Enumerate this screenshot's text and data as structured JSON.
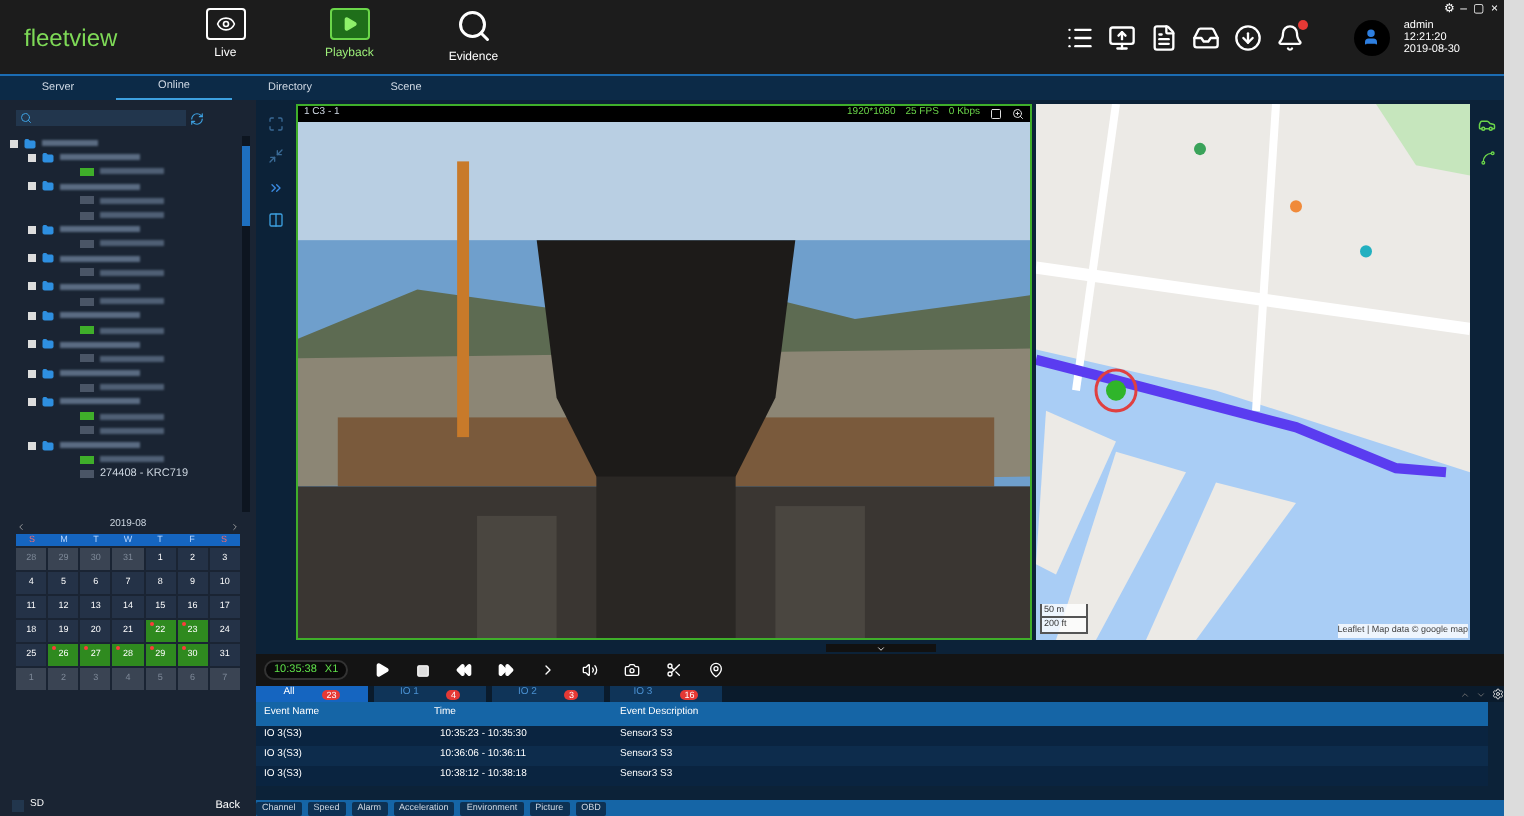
{
  "header": {
    "logo": "fleetview",
    "window_controls": [
      "⚙",
      "–",
      "▢",
      "×"
    ]
  },
  "nav": [
    {
      "kind": "live",
      "label": "Live",
      "selected": false
    },
    {
      "kind": "playback",
      "label": "Playback",
      "selected": true
    },
    {
      "kind": "evidence",
      "label": "Evidence",
      "selected": false
    }
  ],
  "notifications": {
    "unread": true
  },
  "user": {
    "name": "admin",
    "time": "12:21:20",
    "date": "2019-08-30"
  },
  "tabs": [
    {
      "label": "Server",
      "selected": false
    },
    {
      "label": "Online",
      "selected": true
    },
    {
      "label": "Directory",
      "selected": false
    },
    {
      "label": "Scene",
      "selected": false
    }
  ],
  "tree": {
    "checked": false,
    "children": [
      {
        "checked": false,
        "children": [
          {
            "online": true
          }
        ]
      },
      {
        "checked": false,
        "children": [
          {
            "online": false
          },
          {
            "online": false
          }
        ]
      },
      {
        "checked": false,
        "children": [
          {
            "online": false
          }
        ]
      },
      {
        "checked": false,
        "children": [
          {
            "online": false
          }
        ]
      },
      {
        "checked": false,
        "children": [
          {
            "online": false
          }
        ]
      },
      {
        "checked": false,
        "children": [
          {
            "online": true
          }
        ]
      },
      {
        "checked": false,
        "children": [
          {
            "online": false
          }
        ]
      },
      {
        "checked": false,
        "children": [
          {
            "online": false
          }
        ]
      },
      {
        "checked": false,
        "children": [
          {
            "online": true
          },
          {
            "online": false
          }
        ]
      },
      {
        "checked": false,
        "children": [
          {
            "online": true
          },
          {
            "online": false,
            "label": "274408 - KRC719"
          }
        ]
      }
    ]
  },
  "calendar": {
    "month": "2019-08",
    "weekdays": [
      "S",
      "M",
      "T",
      "W",
      "T",
      "F",
      "S"
    ],
    "days": [
      {
        "day": "28",
        "muted": true,
        "recorded": false,
        "alarm": false
      },
      {
        "day": "29",
        "muted": true,
        "recorded": false,
        "alarm": false
      },
      {
        "day": "30",
        "muted": true,
        "recorded": false,
        "alarm": false
      },
      {
        "day": "31",
        "muted": true,
        "recorded": false,
        "alarm": false
      },
      {
        "day": "1",
        "muted": false,
        "recorded": false,
        "alarm": false
      },
      {
        "day": "2",
        "muted": false,
        "recorded": false,
        "alarm": false
      },
      {
        "day": "3",
        "muted": false,
        "recorded": false,
        "alarm": false
      },
      {
        "day": "4",
        "muted": false,
        "recorded": false,
        "alarm": false
      },
      {
        "day": "5",
        "muted": false,
        "recorded": false,
        "alarm": false
      },
      {
        "day": "6",
        "muted": false,
        "recorded": false,
        "alarm": false
      },
      {
        "day": "7",
        "muted": false,
        "recorded": false,
        "alarm": false
      },
      {
        "day": "8",
        "muted": false,
        "recorded": false,
        "alarm": false
      },
      {
        "day": "9",
        "muted": false,
        "recorded": false,
        "alarm": false
      },
      {
        "day": "10",
        "muted": false,
        "recorded": false,
        "alarm": false
      },
      {
        "day": "11",
        "muted": false,
        "recorded": false,
        "alarm": false
      },
      {
        "day": "12",
        "muted": false,
        "recorded": false,
        "alarm": false
      },
      {
        "day": "13",
        "muted": false,
        "recorded": false,
        "alarm": false
      },
      {
        "day": "14",
        "muted": false,
        "recorded": false,
        "alarm": false
      },
      {
        "day": "15",
        "muted": false,
        "recorded": false,
        "alarm": false
      },
      {
        "day": "16",
        "muted": false,
        "recorded": false,
        "alarm": false
      },
      {
        "day": "17",
        "muted": false,
        "recorded": false,
        "alarm": false
      },
      {
        "day": "18",
        "muted": false,
        "recorded": false,
        "alarm": false
      },
      {
        "day": "19",
        "muted": false,
        "recorded": false,
        "alarm": false
      },
      {
        "day": "20",
        "muted": false,
        "recorded": false,
        "alarm": false
      },
      {
        "day": "21",
        "muted": false,
        "recorded": false,
        "alarm": false
      },
      {
        "day": "22",
        "muted": false,
        "recorded": true,
        "alarm": true
      },
      {
        "day": "23",
        "muted": false,
        "recorded": true,
        "alarm": true
      },
      {
        "day": "24",
        "muted": false,
        "recorded": false,
        "alarm": false
      },
      {
        "day": "25",
        "muted": false,
        "recorded": false,
        "alarm": false
      },
      {
        "day": "26",
        "muted": false,
        "recorded": true,
        "alarm": true
      },
      {
        "day": "27",
        "muted": false,
        "recorded": true,
        "alarm": true
      },
      {
        "day": "28",
        "muted": false,
        "recorded": true,
        "alarm": true
      },
      {
        "day": "29",
        "muted": false,
        "recorded": true,
        "alarm": true
      },
      {
        "day": "30",
        "muted": false,
        "recorded": true,
        "alarm": true
      },
      {
        "day": "31",
        "muted": false,
        "recorded": false,
        "alarm": false
      },
      {
        "day": "1",
        "muted": true,
        "recorded": false,
        "alarm": false
      },
      {
        "day": "2",
        "muted": true,
        "recorded": false,
        "alarm": false
      },
      {
        "day": "3",
        "muted": true,
        "recorded": false,
        "alarm": false
      },
      {
        "day": "4",
        "muted": true,
        "recorded": false,
        "alarm": false
      },
      {
        "day": "5",
        "muted": true,
        "recorded": false,
        "alarm": false
      },
      {
        "day": "6",
        "muted": true,
        "recorded": false,
        "alarm": false
      },
      {
        "day": "7",
        "muted": true,
        "recorded": false,
        "alarm": false
      }
    ]
  },
  "sd": {
    "label": "SD",
    "checked": false
  },
  "back": "Back",
  "video": {
    "channel": "1 C3 - 1",
    "stats": [
      "1920*1080",
      "25 FPS",
      "0 Kbps"
    ]
  },
  "map": {
    "scale": [
      "50 m",
      "200 ft"
    ],
    "attribution": "Leaflet | Map data © google map"
  },
  "playback": {
    "time": "10:35:38",
    "speed": "X1"
  },
  "event_tabs": [
    {
      "label": "All",
      "count": "23",
      "selected": true
    },
    {
      "label": "IO 1",
      "count": "4",
      "selected": false
    },
    {
      "label": "IO 2",
      "count": "3",
      "selected": false
    },
    {
      "label": "IO 3",
      "count": "16",
      "selected": false
    }
  ],
  "events": {
    "columns": [
      "Event Name",
      "Time",
      "Event Description"
    ],
    "rows": [
      [
        "IO 3(S3)",
        "10:35:23 - 10:35:30",
        "Sensor3 S3"
      ],
      [
        "IO 3(S3)",
        "10:36:06 - 10:36:11",
        "Sensor3 S3"
      ],
      [
        "IO 3(S3)",
        "10:38:12 - 10:38:18",
        "Sensor3 S3"
      ]
    ]
  },
  "bottom_tabs": [
    "Channel",
    "Speed",
    "Alarm",
    "Acceleration",
    "Environment",
    "Picture",
    "OBD"
  ]
}
